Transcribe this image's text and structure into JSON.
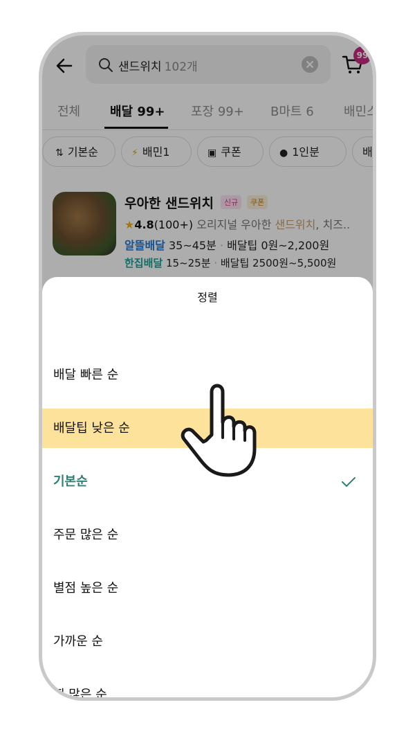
{
  "search": {
    "query": "샌드위치",
    "count": "102개"
  },
  "cart": {
    "badge": "99"
  },
  "tabs": [
    {
      "label": "전체"
    },
    {
      "label": "배달 99+"
    },
    {
      "label": "포장 99+"
    },
    {
      "label": "B마트 6"
    },
    {
      "label": "배민스"
    }
  ],
  "chips": [
    {
      "label": "기본순",
      "icon": "sort-icon"
    },
    {
      "label": "배민1",
      "icon": "baemin1-icon"
    },
    {
      "label": "쿠폰",
      "icon": "coupon-icon"
    },
    {
      "label": "1인분",
      "icon": "single-serving-icon"
    },
    {
      "label": "배달",
      "icon": "delivery-icon"
    }
  ],
  "restaurant": {
    "name": "우아한 샌드위치",
    "tags": [
      "신규",
      "쿠폰"
    ],
    "rating": "4.8",
    "reviews": "(100+)",
    "desc_prefix": "오리지널 우아한 ",
    "desc_highlight": "샌드위치",
    "desc_suffix": ", 치즈..",
    "delivery1": {
      "label": "알뜰배달",
      "time": "35~45분",
      "tip": "배달팁 0원~2,200원"
    },
    "delivery2": {
      "label": "한집배달",
      "time": "15~25분",
      "tip": "배달팁 2500원~5,500원"
    }
  },
  "sheet": {
    "title": "정렬",
    "options": [
      {
        "label": "배달 빠른 순"
      },
      {
        "label": "배달팁 낮은 순"
      },
      {
        "label": "기본순"
      },
      {
        "label": "주문 많은 순"
      },
      {
        "label": "별점 높은 순"
      },
      {
        "label": "가까운 순"
      },
      {
        "label": "찜 많은 순"
      }
    ],
    "highlighted_index": 1,
    "selected_index": 2
  },
  "colors": {
    "highlight": "#fde29b",
    "selected": "#2c8074",
    "badge": "#c42d80"
  }
}
